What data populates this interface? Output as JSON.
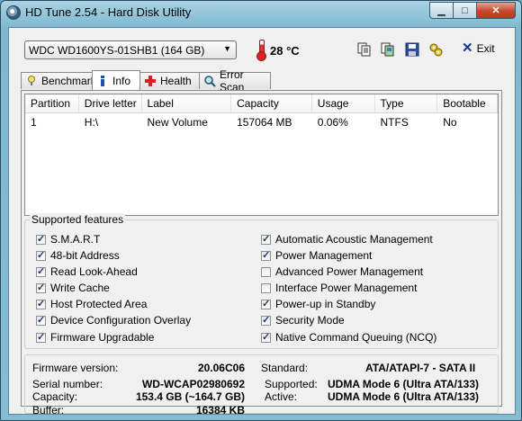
{
  "window": {
    "title": "HD Tune 2.54 - Hard Disk Utility"
  },
  "toolbar": {
    "drive": "WDC WD1600YS-01SHB1 (164 GB)",
    "temperature": "28 °C",
    "exit_label": "Exit",
    "icons": [
      "copy-text-icon",
      "copy-screenshot-icon",
      "save-icon",
      "options-icon"
    ]
  },
  "tabs": [
    {
      "label": "Benchmark",
      "icon": "benchmark-icon"
    },
    {
      "label": "Info",
      "icon": "info-icon",
      "active": true
    },
    {
      "label": "Health",
      "icon": "health-icon"
    },
    {
      "label": "Error Scan",
      "icon": "error-scan-icon"
    }
  ],
  "partitions": {
    "columns": [
      "Partition",
      "Drive letter",
      "Label",
      "Capacity",
      "Usage",
      "Type",
      "Bootable"
    ],
    "rows": [
      [
        "1",
        "H:\\",
        "New Volume",
        "157064 MB",
        "0.06%",
        "NTFS",
        "No"
      ]
    ]
  },
  "features": {
    "legend": "Supported features",
    "left": [
      {
        "label": "S.M.A.R.T",
        "checked": true
      },
      {
        "label": "48-bit Address",
        "checked": true
      },
      {
        "label": "Read Look-Ahead",
        "checked": true
      },
      {
        "label": "Write Cache",
        "checked": true
      },
      {
        "label": "Host Protected Area",
        "checked": true
      },
      {
        "label": "Device Configuration Overlay",
        "checked": true
      },
      {
        "label": "Firmware Upgradable",
        "checked": true
      }
    ],
    "right": [
      {
        "label": "Automatic Acoustic Management",
        "checked": true
      },
      {
        "label": "Power Management",
        "checked": true
      },
      {
        "label": "Advanced Power Management",
        "checked": false
      },
      {
        "label": "Interface Power Management",
        "checked": false
      },
      {
        "label": "Power-up in Standby",
        "checked": true
      },
      {
        "label": "Security Mode",
        "checked": true
      },
      {
        "label": "Native Command Queuing (NCQ)",
        "checked": true
      }
    ]
  },
  "info": {
    "firmware_label": "Firmware version:",
    "firmware": "20.06C06",
    "serial_label": "Serial number:",
    "serial": "WD-WCAP02980692",
    "capacity_label": "Capacity:",
    "capacity": "153.4 GB (~164.7 GB)",
    "buffer_label": "Buffer:",
    "buffer": "16384 KB",
    "standard_label": "Standard:",
    "standard": "ATA/ATAPI-7 - SATA II",
    "supported_label": "Supported:",
    "supported": "UDMA Mode 6 (Ultra ATA/133)",
    "active_label": "Active:",
    "active": "UDMA Mode 6 (Ultra ATA/133)"
  },
  "colors": {
    "title_gradient": "#7fb8cf",
    "close_button": "#c9462c",
    "temperature_icon": "#d22222"
  }
}
